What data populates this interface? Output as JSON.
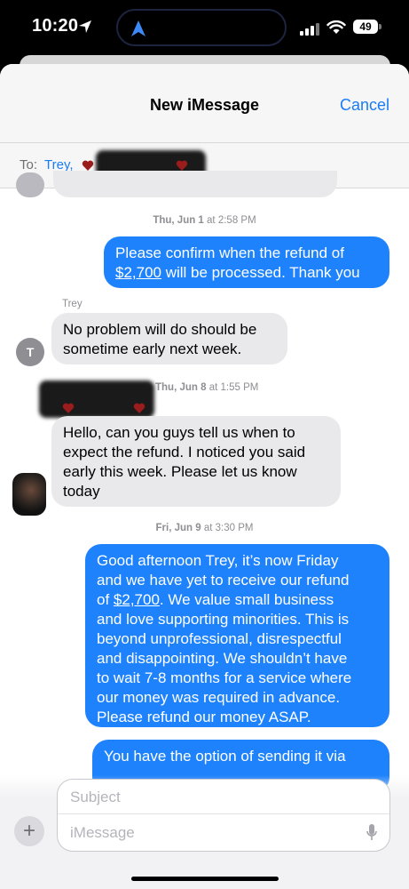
{
  "status_bar": {
    "time": "10:20",
    "battery": "49"
  },
  "header": {
    "title": "New iMessage",
    "cancel_label": "Cancel"
  },
  "to_field": {
    "label": "To:",
    "recipient": "Trey,"
  },
  "messages": {
    "ts1": {
      "day": "Thu, Jun 1",
      "at": "at",
      "time": "2:58 PM"
    },
    "out1": {
      "line1": "Please confirm when the refund of",
      "amount": "$2,700",
      "line2_rest": " will be processed. Thank you"
    },
    "sender_trey": "Trey",
    "in1": {
      "line1": "No problem will do should be",
      "line2": "sometime early next week."
    },
    "avatar_trey": "T",
    "ts2": {
      "day": "Thu, Jun 8",
      "at": "at",
      "time": "1:55 PM"
    },
    "in2": {
      "line1": "Hello, can you guys tell us when to",
      "line2": "expect the refund. I noticed you said",
      "line3": "early this week. Please let us know",
      "line4": "today"
    },
    "ts3": {
      "day": "Fri, Jun 9",
      "at": "at",
      "time": "3:30 PM"
    },
    "out2": {
      "line1": "Good afternoon Trey, it’s now Friday",
      "line2": "and we have yet to receive our refund",
      "line3_pre": "of ",
      "amount": "$2,700",
      "line3_post": ". We value small business",
      "line4": "and love supporting minorities. This is",
      "line5": "beyond unprofessional, disrespectful",
      "line6": "and disappointing. We shouldn’t have",
      "line7": "to wait 7-8 months for a service where",
      "line8": "our money was required in advance.",
      "line9": "Please refund our money ASAP."
    },
    "out3": {
      "line1": "You have the option of sending it via"
    }
  },
  "composer": {
    "subject_placeholder": "Subject",
    "message_placeholder": "iMessage",
    "plus_label": "+"
  },
  "colors": {
    "accent": "#1a7cf5",
    "outgoing_bubble": "#1d82fb",
    "incoming_bubble": "#e9e9eb"
  }
}
